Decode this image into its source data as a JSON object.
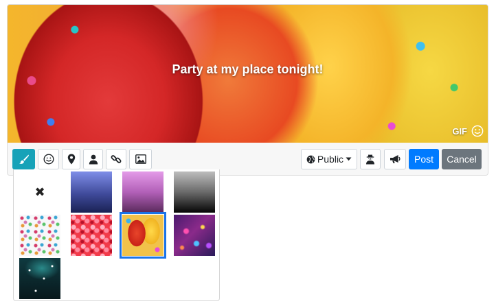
{
  "post": {
    "text": "Party at my place tonight!",
    "gif_badge": "GIF"
  },
  "toolbar": {
    "left_tools": [
      {
        "name": "background",
        "icon": "paintbrush-icon",
        "active": true
      },
      {
        "name": "emoji",
        "icon": "smiley-icon"
      },
      {
        "name": "location",
        "icon": "map-marker-icon"
      },
      {
        "name": "tag-people",
        "icon": "user-icon"
      },
      {
        "name": "link",
        "icon": "link-icon"
      },
      {
        "name": "image",
        "icon": "image-icon"
      }
    ],
    "privacy_label": "Public",
    "post_label": "Post",
    "cancel_label": "Cancel"
  },
  "background_picker": {
    "selected_index": 6,
    "options": [
      {
        "id": "none",
        "symbol": "✖"
      },
      {
        "id": "blue-gradient"
      },
      {
        "id": "pink-gradient"
      },
      {
        "id": "gray-gradient"
      },
      {
        "id": "hearts-white"
      },
      {
        "id": "hearts-red"
      },
      {
        "id": "balloons"
      },
      {
        "id": "galaxy"
      },
      {
        "id": "space"
      }
    ]
  },
  "colors": {
    "active_tool": "#17a2b8",
    "primary": "#007bff",
    "secondary": "#6c757d",
    "selection_outline": "#1a73e8"
  }
}
